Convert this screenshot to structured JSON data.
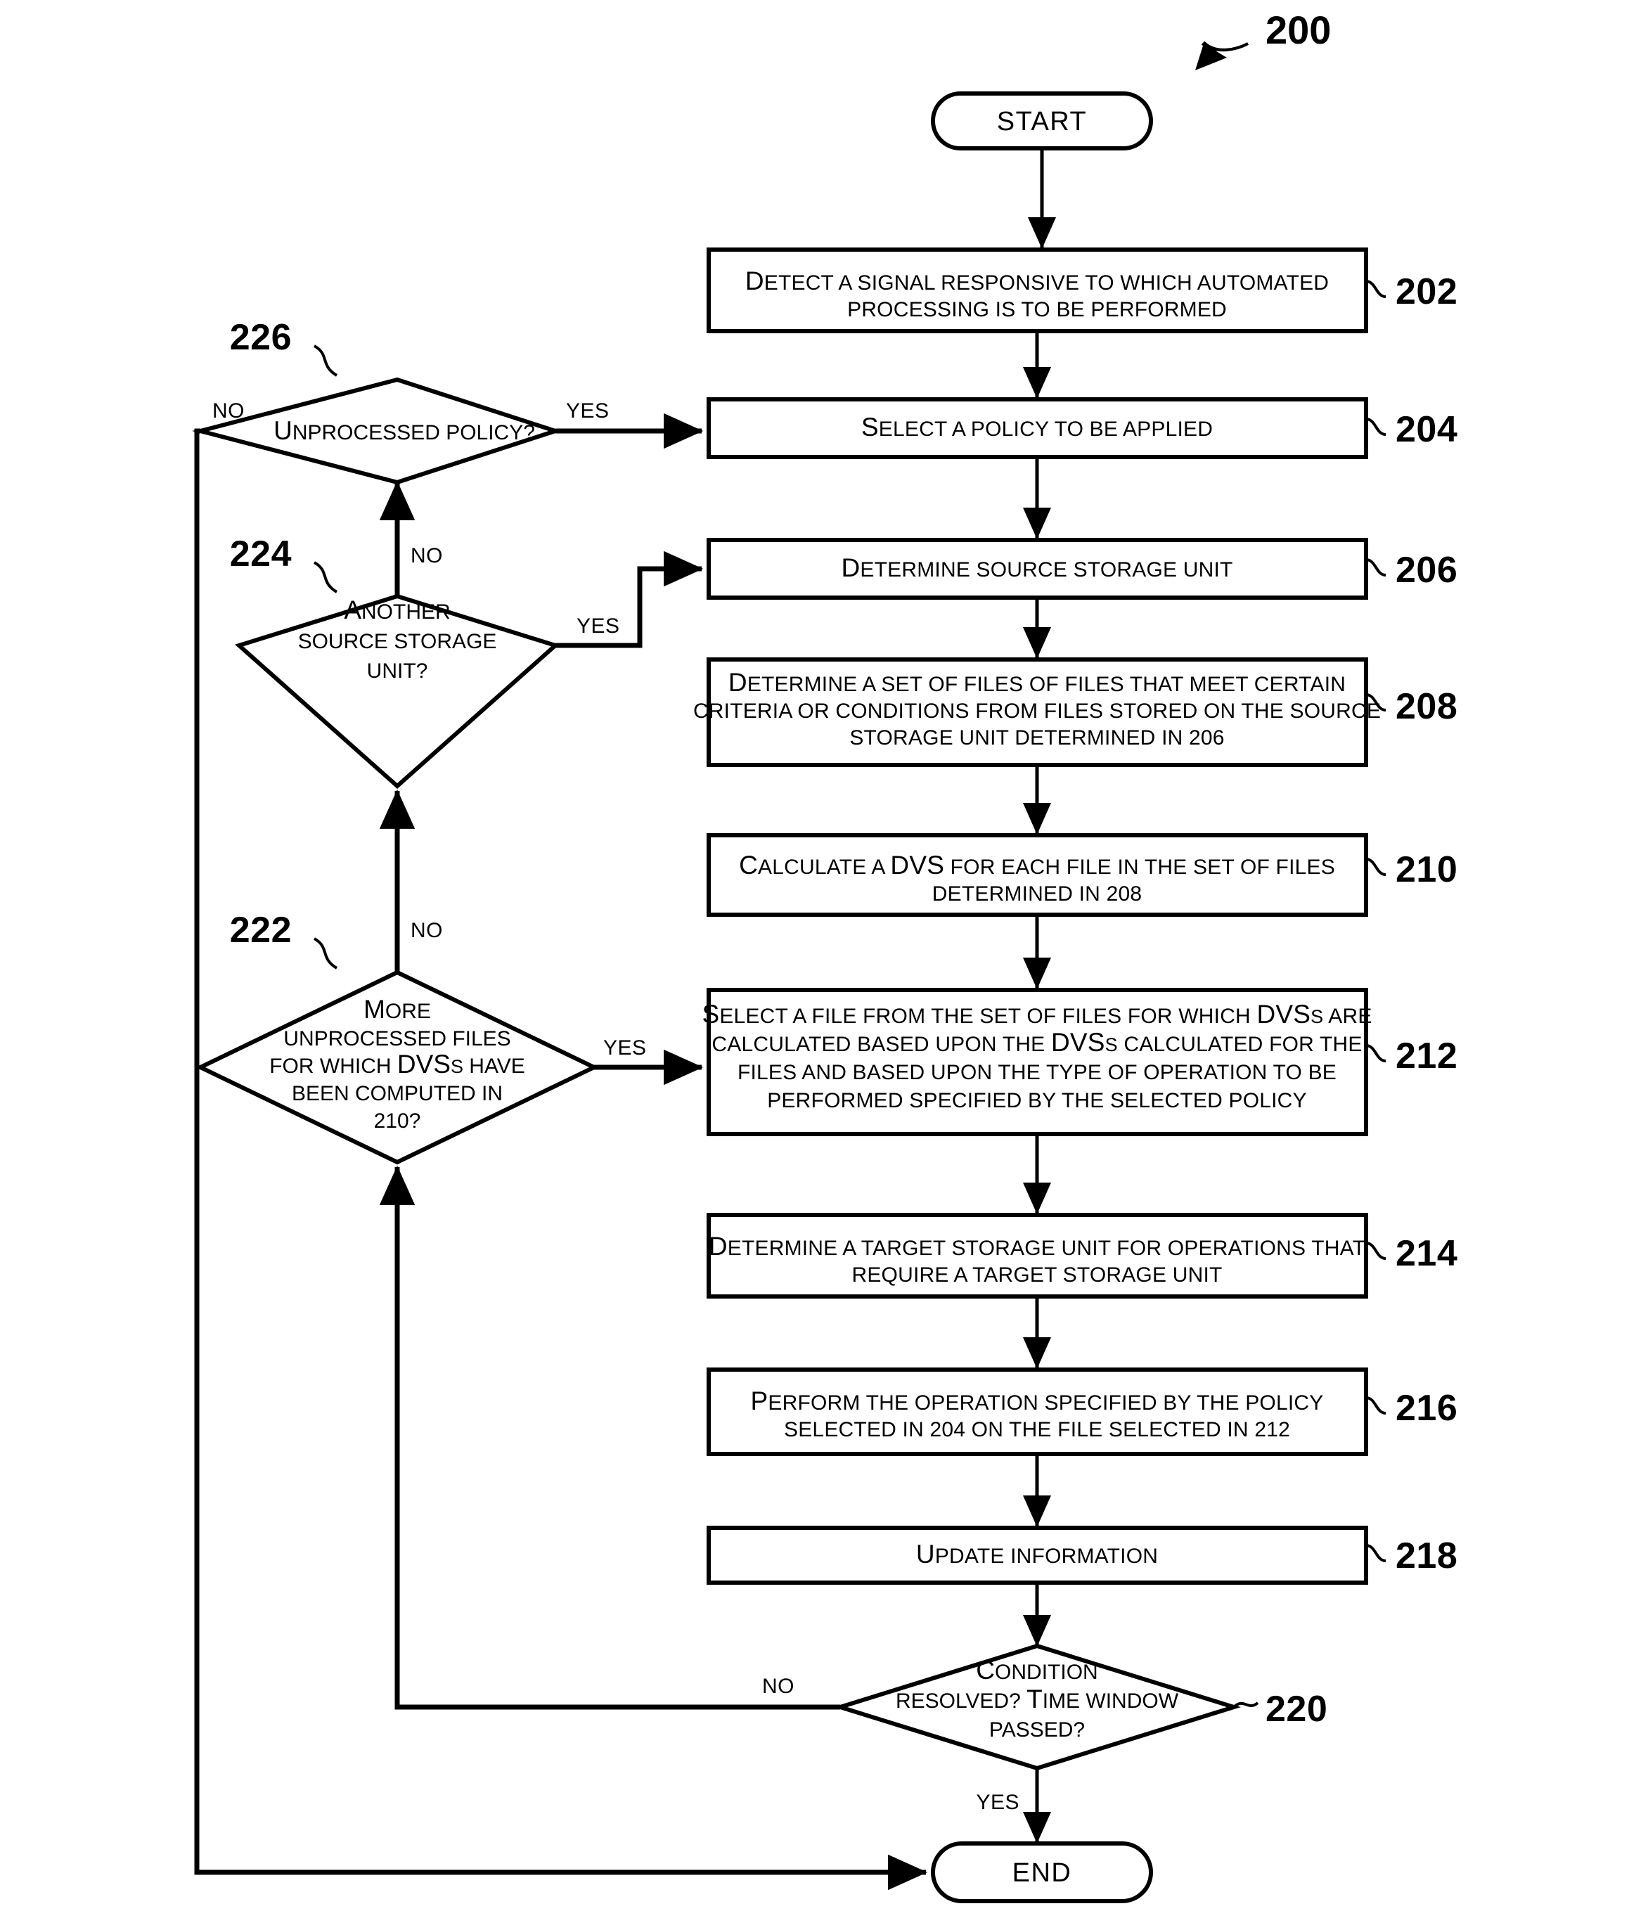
{
  "figure": {
    "reference_label": "200"
  },
  "nodes": {
    "start": {
      "label": "START",
      "type": "terminal"
    },
    "end": {
      "label": "END",
      "type": "terminal"
    },
    "step202": {
      "ref": "202",
      "lines": [
        "Detect a signal responsive to which automated",
        "processing is to be performed"
      ]
    },
    "step204": {
      "ref": "204",
      "lines": [
        "Select a policy to be applied"
      ]
    },
    "step206": {
      "ref": "206",
      "lines": [
        "Determine source storage unit"
      ]
    },
    "step208": {
      "ref": "208",
      "lines": [
        "Determine a set of files of files that meet certain",
        "criteria or conditions from files stored on the source",
        "storage unit determined in 206"
      ]
    },
    "step210": {
      "ref": "210",
      "lines": [
        "Calculate a DVS for each file in the set of files",
        "determined in 208"
      ]
    },
    "step212": {
      "ref": "212",
      "lines": [
        "Select a file from the set of files for which DVSs are",
        "calculated  based upon the DVSs calculated for the",
        "files and based upon the type of operation to be",
        "performed specified by the selected policy"
      ]
    },
    "step214": {
      "ref": "214",
      "lines": [
        "Determine a target storage unit for operations that",
        "require a target storage unit"
      ]
    },
    "step216": {
      "ref": "216",
      "lines": [
        "Perform the operation specified by the policy",
        "selected in 204 on the file selected in 212"
      ]
    },
    "step218": {
      "ref": "218",
      "lines": [
        "Update information"
      ]
    },
    "decision220": {
      "ref": "220",
      "lines": [
        "Condition",
        "resolved?  Time window",
        "passed?"
      ]
    },
    "decision222": {
      "ref": "222",
      "lines": [
        "More",
        "unprocessed files",
        "for which DVSs have",
        "been computed in",
        "210?"
      ]
    },
    "decision224": {
      "ref": "224",
      "lines": [
        "Another",
        "source storage",
        "unit?"
      ]
    },
    "decision226": {
      "ref": "226",
      "lines": [
        "Unprocessed policy?"
      ]
    }
  },
  "edge_labels": {
    "d226_no": "NO",
    "d226_yes": "YES",
    "d224_no": "NO",
    "d224_yes": "YES",
    "d222_no": "NO",
    "d222_yes": "YES",
    "d220_no": "NO",
    "d220_yes": "YES"
  },
  "colors": {
    "stroke": "#000000",
    "fill": "#ffffff"
  }
}
